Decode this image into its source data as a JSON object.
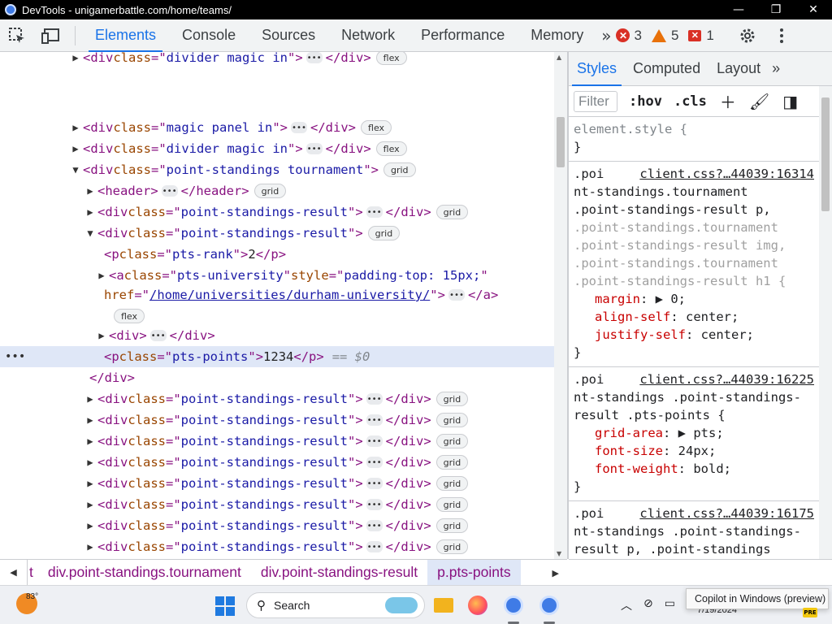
{
  "window": {
    "title": "DevTools - unigamerbattle.com/home/teams/",
    "minimize": "—",
    "restore": "❐",
    "close": "✕"
  },
  "toolbar": {
    "tabs": [
      "Elements",
      "Console",
      "Sources",
      "Network",
      "Performance",
      "Memory"
    ],
    "more": "»",
    "errors": "3",
    "warnings": "5",
    "issues": "1"
  },
  "elements": {
    "lines": [
      {
        "tri": "▶",
        "open": "<div ",
        "attrs": [
          {
            "n": "class",
            "v": "divider magic in"
          }
        ],
        "close": ">",
        "ell": true,
        "end": "</div>",
        "badge": "flex"
      },
      {
        "tri": "▶",
        "open": "<div ",
        "attrs": [
          {
            "n": "class",
            "v": "magic panel in"
          }
        ],
        "close": ">",
        "ell": true,
        "end": "</div>",
        "badge": "flex"
      },
      {
        "tri": "▶",
        "open": "<div ",
        "attrs": [
          {
            "n": "class",
            "v": "divider magic in"
          }
        ],
        "close": ">",
        "ell": true,
        "end": "</div>",
        "badge": "flex"
      },
      {
        "tri": "▼",
        "open": "<div ",
        "attrs": [
          {
            "n": "class",
            "v": "point-standings tournament"
          }
        ],
        "close": ">",
        "badge": "grid"
      },
      {
        "tri": "▶",
        "open": "<header>",
        "ell": true,
        "end": "</header>",
        "badge": "grid"
      },
      {
        "tri": "▶",
        "open": "<div ",
        "attrs": [
          {
            "n": "class",
            "v": "point-standings-result"
          }
        ],
        "close": ">",
        "ell": true,
        "end": "</div>",
        "badge": "grid"
      },
      {
        "tri": "▼",
        "open": "<div ",
        "attrs": [
          {
            "n": "class",
            "v": "point-standings-result"
          }
        ],
        "close": ">",
        "badge": "grid"
      },
      {
        "tri": "",
        "open": "<p ",
        "attrs": [
          {
            "n": "class",
            "v": "pts-rank"
          }
        ],
        "close": ">",
        "text": "2",
        "end": "</p>"
      },
      {
        "tri": "▶",
        "open": "<a ",
        "attrs": [
          {
            "n": "class",
            "v": "pts-university"
          },
          {
            "n": "style",
            "v": "padding-top: 15px;"
          }
        ]
      },
      {
        "tri": "",
        "hrefLabel": "href",
        "href": "/home/universities/durham-university/",
        "close": ">",
        "ell": true,
        "end": "</a>"
      },
      {
        "tri": "",
        "badge": "flex"
      },
      {
        "tri": "▶",
        "open": "<div>",
        "ell": true,
        "end": "</div>"
      },
      {
        "tri": "",
        "open": "<p ",
        "attrs": [
          {
            "n": "class",
            "v": "pts-points"
          }
        ],
        "close": ">",
        "text": "1234",
        "end": "</p>",
        "dollar": "== $0",
        "selected": true
      },
      {
        "tri": "",
        "end": "</div>"
      },
      {
        "tri": "▶",
        "open": "<div ",
        "attrs": [
          {
            "n": "class",
            "v": "point-standings-result"
          }
        ],
        "close": ">",
        "ell": true,
        "end": "</div>",
        "badge": "grid"
      },
      {
        "tri": "▶",
        "open": "<div ",
        "attrs": [
          {
            "n": "class",
            "v": "point-standings-result"
          }
        ],
        "close": ">",
        "ell": true,
        "end": "</div>",
        "badge": "grid"
      },
      {
        "tri": "▶",
        "open": "<div ",
        "attrs": [
          {
            "n": "class",
            "v": "point-standings-result"
          }
        ],
        "close": ">",
        "ell": true,
        "end": "</div>",
        "badge": "grid"
      },
      {
        "tri": "▶",
        "open": "<div ",
        "attrs": [
          {
            "n": "class",
            "v": "point-standings-result"
          }
        ],
        "close": ">",
        "ell": true,
        "end": "</div>",
        "badge": "grid"
      },
      {
        "tri": "▶",
        "open": "<div ",
        "attrs": [
          {
            "n": "class",
            "v": "point-standings-result"
          }
        ],
        "close": ">",
        "ell": true,
        "end": "</div>",
        "badge": "grid"
      },
      {
        "tri": "▶",
        "open": "<div ",
        "attrs": [
          {
            "n": "class",
            "v": "point-standings-result"
          }
        ],
        "close": ">",
        "ell": true,
        "end": "</div>",
        "badge": "grid"
      },
      {
        "tri": "▶",
        "open": "<div ",
        "attrs": [
          {
            "n": "class",
            "v": "point-standings-result"
          }
        ],
        "close": ">",
        "ell": true,
        "end": "</div>",
        "badge": "grid"
      },
      {
        "tri": "▶",
        "open": "<div ",
        "attrs": [
          {
            "n": "class",
            "v": "point-standings-result"
          }
        ],
        "close": ">",
        "ell": true,
        "end": "</div>",
        "badge": "grid"
      },
      {
        "tri": "▶",
        "open": "<div ",
        "attrs": [
          {
            "n": "class",
            "v": "point-standings-result"
          }
        ],
        "close": ">",
        "ell": true,
        "end": "</div>",
        "badge": "grid"
      },
      {
        "tri": "▶",
        "open": "<div ",
        "attrs": [
          {
            "n": "class",
            "v": "point-standings-result"
          }
        ],
        "close": ">",
        "ell": true,
        "end": "</div>",
        "badge": "grid"
      },
      {
        "tri": "▶",
        "open": "<div ",
        "attrs": [
          {
            "n": "class",
            "v": "point-standings-result"
          }
        ],
        "close": ">",
        "ell": true,
        "end": "</div>",
        "badge": "grid"
      }
    ]
  },
  "styles": {
    "tabs": [
      "Styles",
      "Computed",
      "Layout"
    ],
    "more": "»",
    "filter_placeholder": "Filter",
    "hov": ":hov",
    "cls": ".cls",
    "element_style": "element.style {",
    "brace_close": "}",
    "rules": [
      {
        "source": "client.css?…44039:16314",
        "selectors": [
          {
            "t": ".poi",
            "dim": false
          },
          {
            "t": "nt-standings.tournament",
            "dim": false
          },
          {
            "t": ".point-standings-result p,",
            "dim": false
          },
          {
            "t": ".point-standings.tournament",
            "dim": true
          },
          {
            "t": ".point-standings-result img,",
            "dim": true
          },
          {
            "t": ".point-standings.tournament",
            "dim": true
          },
          {
            "t": ".point-standings-result h1 {",
            "dim": true
          }
        ],
        "props": [
          {
            "n": "margin",
            "v": "▶ 0;"
          },
          {
            "n": "align-self",
            "v": "center;"
          },
          {
            "n": "justify-self",
            "v": "center;"
          }
        ]
      },
      {
        "source": "client.css?…44039:16225",
        "selectors": [
          {
            "t": ".poi",
            "dim": false
          },
          {
            "t": "nt-standings .point-standings-",
            "dim": false
          },
          {
            "t": "result .pts-points {",
            "dim": false
          }
        ],
        "props": [
          {
            "n": "grid-area",
            "v": "▶ pts;"
          },
          {
            "n": "font-size",
            "v": "24px;"
          },
          {
            "n": "font-weight",
            "v": "bold;"
          }
        ]
      },
      {
        "source": "client.css?…44039:16175",
        "selectors": [
          {
            "t": ".poi",
            "dim": false
          },
          {
            "t": "nt-standings .point-standings-",
            "dim": false
          },
          {
            "t": "result p, .point-standings",
            "dim": false
          },
          {
            "t": ".point-standings-result img,",
            "dim": true
          }
        ],
        "props": []
      }
    ]
  },
  "breadcrumb": {
    "items": [
      "t",
      "div.point-standings.tournament",
      "div.point-standings-result",
      "p.pts-points"
    ]
  },
  "taskbar": {
    "temp": "83°",
    "search": "Search",
    "date": "7/19/2024",
    "tooltip": "Copilot in Windows (preview)",
    "pre": "PRE"
  }
}
